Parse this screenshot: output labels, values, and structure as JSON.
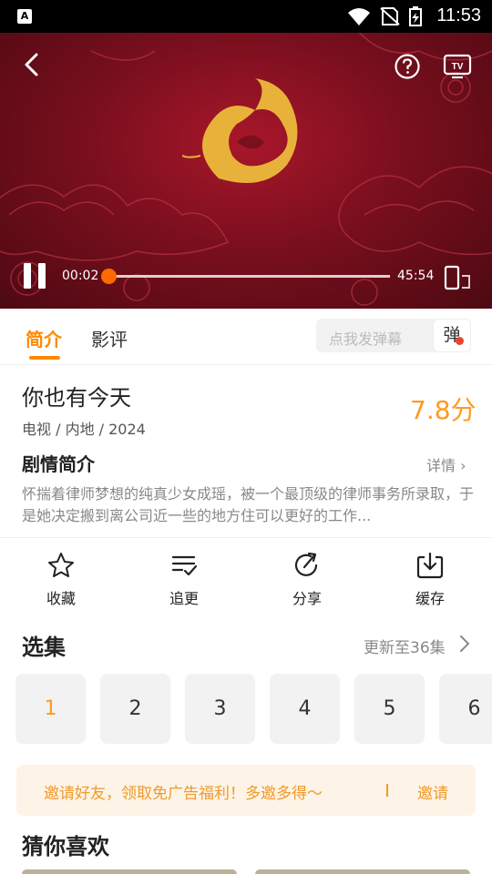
{
  "status_bar": {
    "time": "11:53",
    "badge": "A"
  },
  "player": {
    "current_time": "00:02",
    "total_time": "45:54",
    "progress": 0.001,
    "accent_color": "#ff6a00",
    "icons": [
      "back-icon",
      "help-icon",
      "tv-cast-icon",
      "pause-icon",
      "rotate-screen-icon"
    ]
  },
  "tabs": {
    "intro": "简介",
    "review": "影评",
    "danmaku_placeholder": "点我发弹幕",
    "danmaku_button": "弹"
  },
  "show": {
    "title": "你也有今天",
    "score": "7.8分",
    "meta": "电视 / 内地 / 2024",
    "synopsis_title": "剧情简介",
    "detail_link": "详情 ›",
    "synopsis": "怀揣着律师梦想的纯真少女成瑶，被一个最顶级的律师事务所录取，于是她决定搬到离公司近一些的地方住可以更好的工作..."
  },
  "actions": [
    {
      "label": "收藏",
      "icon": "star-icon"
    },
    {
      "label": "追更",
      "icon": "playlist-check-icon"
    },
    {
      "label": "分享",
      "icon": "share-icon"
    },
    {
      "label": "缓存",
      "icon": "download-icon"
    }
  ],
  "episodes": {
    "title": "选集",
    "update": "更新至36集",
    "items": [
      "1",
      "2",
      "3",
      "4",
      "5",
      "6"
    ],
    "selected": "1"
  },
  "invite": {
    "text": "邀请好友，领取免广告福利！多邀多得～",
    "button": "邀请"
  },
  "guess": {
    "title": "猜你喜欢"
  },
  "colors": {
    "accent": "#ff8a00",
    "score": "#ff9a1f",
    "invite": "#f09a2a"
  }
}
